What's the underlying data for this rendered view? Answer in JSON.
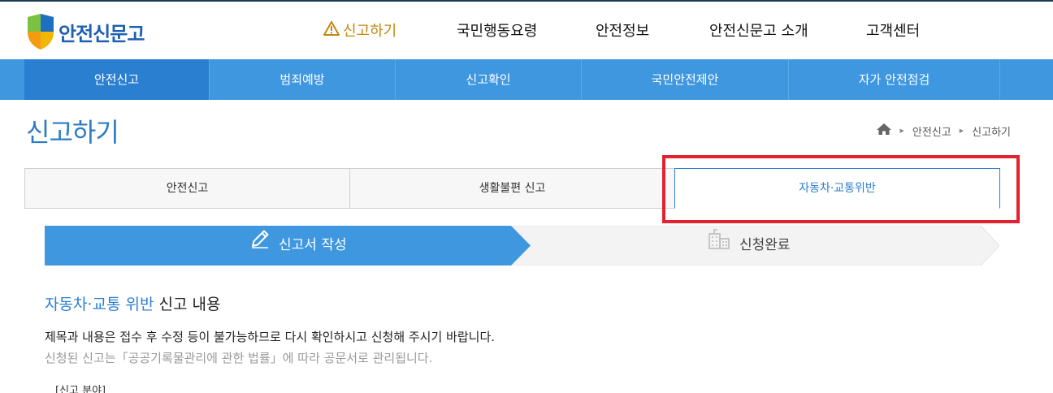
{
  "header": {
    "logo_text": "안전신문고",
    "menu": [
      {
        "label": "신고하기",
        "active": true
      },
      {
        "label": "국민행동요령"
      },
      {
        "label": "안전정보"
      },
      {
        "label": "안전신문고 소개"
      },
      {
        "label": "고객센터"
      }
    ]
  },
  "subnav": {
    "items": [
      {
        "label": "안전신고",
        "active": true
      },
      {
        "label": "범죄예방"
      },
      {
        "label": "신고확인"
      },
      {
        "label": "국민안전제안"
      },
      {
        "label": "자가 안전점검"
      }
    ]
  },
  "page": {
    "title": "신고하기",
    "breadcrumb": [
      "안전신고",
      "신고하기"
    ]
  },
  "tabs": [
    {
      "label": "안전신고"
    },
    {
      "label": "생활불편 신고"
    },
    {
      "label": "자동차·교통위반",
      "active": true
    }
  ],
  "steps": [
    {
      "label": "신고서 작성",
      "active": true
    },
    {
      "label": "신청완료"
    }
  ],
  "content": {
    "title_highlight": "자동차·교통 위반",
    "title_rest": " 신고 내용",
    "notice_1": "제목과 내용은 접수 후 수정 등이 불가능하므로 다시 확인하시고 신청해 주시기 바랍니다.",
    "notice_2": "신청된 신고는「공공기록물관리에 관한 법률」에 따라 공문서로 관리됩니다.",
    "field_label": "[신고 분야]"
  },
  "colors": {
    "brand_blue": "#3f97e0",
    "active_blue": "#2b7fd1",
    "menu_active": "#c4860f",
    "highlight_red": "#e0232e"
  }
}
